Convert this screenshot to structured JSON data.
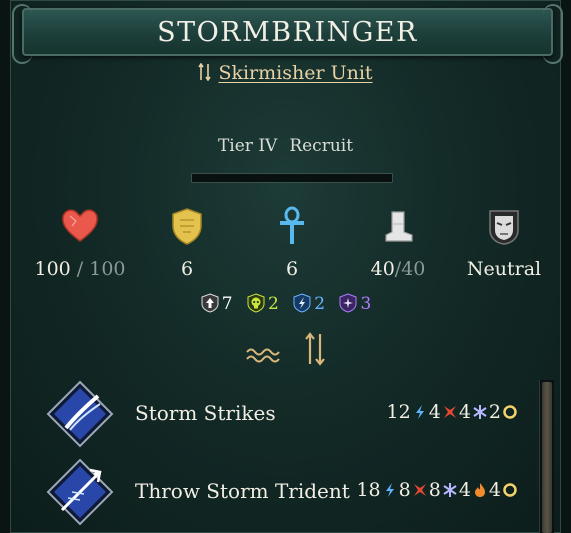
{
  "unit": {
    "name": "STORMBRINGER",
    "class_label": "Skirmisher Unit",
    "tier": "Tier IV",
    "rank": "Recruit",
    "xp_progress": 0
  },
  "stats": {
    "health_current": "100",
    "health_sep": "/",
    "health_max": "100",
    "defense": "6",
    "resistance": "6",
    "movement_current": "40",
    "movement_sep": "/",
    "movement_max": "40",
    "morale": "Neutral"
  },
  "modifiers": [
    {
      "icon": "armor-up-icon",
      "value": "7",
      "color": "#ffffff"
    },
    {
      "icon": "blight-skull-icon",
      "value": "2",
      "color": "#c8e640"
    },
    {
      "icon": "lightning-shield-icon",
      "value": "2",
      "color": "#6ab4ff"
    },
    {
      "icon": "spirit-shield-icon",
      "value": "3",
      "color": "#b07cff"
    }
  ],
  "traits": [
    "waves-trait-icon",
    "skirmisher-trait-icon"
  ],
  "abilities": [
    {
      "name": "Storm Strikes",
      "damage": [
        {
          "value": "12",
          "type": "lightning-damage-icon"
        },
        {
          "value": "4",
          "type": "physical-damage-icon"
        },
        {
          "value": "4",
          "type": "frost-damage-icon"
        },
        {
          "value": "2",
          "type": "accuracy-ring-icon"
        }
      ]
    },
    {
      "name": "Throw Storm Trident",
      "damage": [
        {
          "value": "18",
          "type": "lightning-damage-icon"
        },
        {
          "value": "8",
          "type": "physical-damage-icon"
        },
        {
          "value": "8",
          "type": "frost-damage-icon"
        },
        {
          "value": "4",
          "type": "fire-damage-icon"
        },
        {
          "value": "4",
          "type": "accuracy-ring-icon"
        }
      ]
    }
  ],
  "colors": {
    "panel": "#132a27",
    "title_bar": "#1c3d39",
    "accent_gold": "#e7d2a6"
  }
}
